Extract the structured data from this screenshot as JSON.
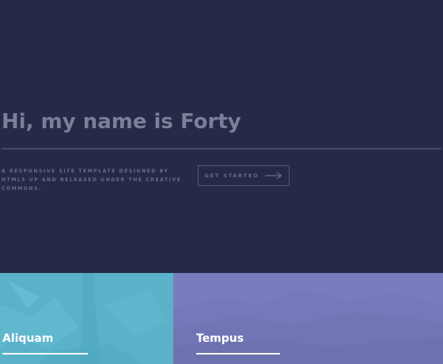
{
  "banner": {
    "title": "Hi, my name is Forty",
    "description": "A responsive site template designed by HTML5 UP and released under the Creative Commons.",
    "button_label": "Get Started"
  },
  "tiles": [
    {
      "title": "Aliquam",
      "color": "#5ab2ca"
    },
    {
      "title": "Tempus",
      "color": "#7a7dbd"
    }
  ],
  "colors": {
    "background": "#252a47",
    "title_text": "#7b7f99",
    "muted_text": "#696d88"
  },
  "icons": {
    "button_icon": "arrow-right-icon"
  }
}
